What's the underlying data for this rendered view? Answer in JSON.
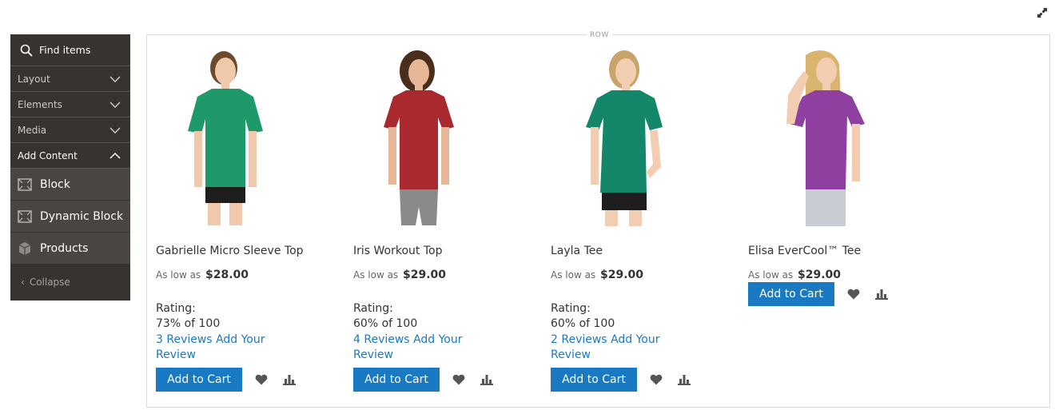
{
  "panel": {
    "search_label": "Find items",
    "sections": [
      {
        "label": "Layout",
        "expanded": false
      },
      {
        "label": "Elements",
        "expanded": false
      },
      {
        "label": "Media",
        "expanded": false
      },
      {
        "label": "Add Content",
        "expanded": true
      }
    ],
    "items": [
      {
        "label": "Block",
        "icon": "block-icon"
      },
      {
        "label": "Dynamic Block",
        "icon": "dynamic-block-icon"
      },
      {
        "label": "Products",
        "icon": "products-box-icon"
      }
    ],
    "collapse_label": "Collapse"
  },
  "stage": {
    "row_label": "ROW"
  },
  "products": [
    {
      "name": "Gabrielle Micro Sleeve Top",
      "price_prefix": "As low as",
      "price": "$28.00",
      "rating_label": "Rating:",
      "rating_value": "73% of 100",
      "reviews_link": "3  Reviews",
      "add_review_link": "Add Your Review",
      "cart_label": "Add to Cart",
      "shirt_color": "#1e9a6a",
      "hair_color": "#6b4a2e",
      "bottom_color": "#1e1e1e"
    },
    {
      "name": "Iris Workout Top",
      "price_prefix": "As low as",
      "price": "$29.00",
      "rating_label": "Rating:",
      "rating_value": "60% of 100",
      "reviews_link": "4  Reviews",
      "add_review_link": "Add Your Review",
      "cart_label": "Add to Cart",
      "shirt_color": "#a82a2e",
      "hair_color": "#4a2e1c",
      "bottom_color": "#8a8a8a"
    },
    {
      "name": "Layla Tee",
      "price_prefix": "As low as",
      "price": "$29.00",
      "rating_label": "Rating:",
      "rating_value": "60% of 100",
      "reviews_link": "2  Reviews",
      "add_review_link": "Add Your Review",
      "cart_label": "Add to Cart",
      "shirt_color": "#14866a",
      "hair_color": "#c9a46a",
      "bottom_color": "#1e1e1e"
    },
    {
      "name": "Elisa EverCool™ Tee",
      "price_prefix": "As low as",
      "price": "$29.00",
      "cart_label": "Add to Cart",
      "shirt_color": "#8e3fa0",
      "hair_color": "#d9b46e",
      "bottom_color": "#c8ccd2"
    }
  ],
  "colors": {
    "accent": "#1979c3",
    "panel_bg": "#373330",
    "panel_item_bg": "#4a4541"
  }
}
